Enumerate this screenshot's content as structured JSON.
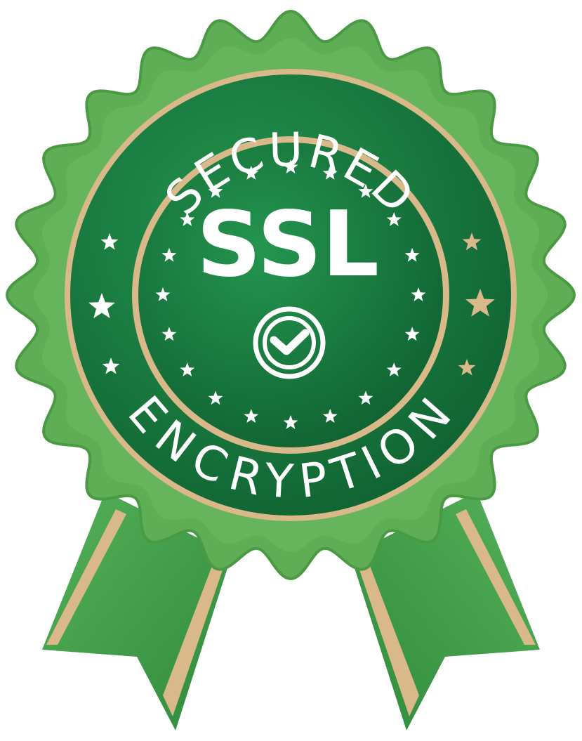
{
  "badge": {
    "top_text": "SECURED",
    "center_text": "SSL",
    "bottom_text": "ENCRYPTION",
    "center_icon": "check-circle-icon",
    "star_icon": "star-icon"
  },
  "colors": {
    "outer_green": "#5fae55",
    "outer_green_dark": "#4a9a44",
    "inner_green": "#1f8446",
    "inner_green_dark": "#0f5f30",
    "gold": "#d9b88a",
    "text": "#ffffff",
    "ribbon_green": "#4caa52",
    "ribbon_dark": "#2f7a38"
  }
}
